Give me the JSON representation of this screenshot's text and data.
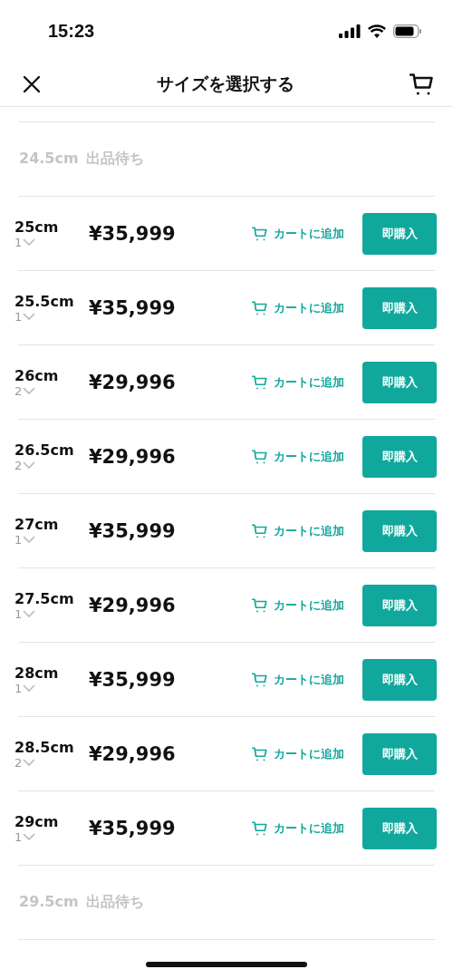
{
  "status_bar": {
    "time": "15:23"
  },
  "header": {
    "title": "サイズを選択する"
  },
  "sizes": [
    {
      "kind": "waiting",
      "size": "24.5cm",
      "status": "出品待ち"
    },
    {
      "kind": "available",
      "size": "25cm",
      "quantity": "1",
      "price": "¥35,999",
      "cart": "カートに追加",
      "buy": "即購入"
    },
    {
      "kind": "available",
      "size": "25.5cm",
      "quantity": "1",
      "price": "¥35,999",
      "cart": "カートに追加",
      "buy": "即購入"
    },
    {
      "kind": "available",
      "size": "26cm",
      "quantity": "2",
      "price": "¥29,996",
      "cart": "カートに追加",
      "buy": "即購入"
    },
    {
      "kind": "available",
      "size": "26.5cm",
      "quantity": "2",
      "price": "¥29,996",
      "cart": "カートに追加",
      "buy": "即購入"
    },
    {
      "kind": "available",
      "size": "27cm",
      "quantity": "1",
      "price": "¥35,999",
      "cart": "カートに追加",
      "buy": "即購入"
    },
    {
      "kind": "available",
      "size": "27.5cm",
      "quantity": "1",
      "price": "¥29,996",
      "cart": "カートに追加",
      "buy": "即購入"
    },
    {
      "kind": "available",
      "size": "28cm",
      "quantity": "1",
      "price": "¥35,999",
      "cart": "カートに追加",
      "buy": "即購入"
    },
    {
      "kind": "available",
      "size": "28.5cm",
      "quantity": "2",
      "price": "¥29,996",
      "cart": "カートに追加",
      "buy": "即購入"
    },
    {
      "kind": "available",
      "size": "29cm",
      "quantity": "1",
      "price": "¥35,999",
      "cart": "カートに追加",
      "buy": "即購入"
    },
    {
      "kind": "waiting",
      "size": "29.5cm",
      "status": "出品待ち"
    }
  ]
}
